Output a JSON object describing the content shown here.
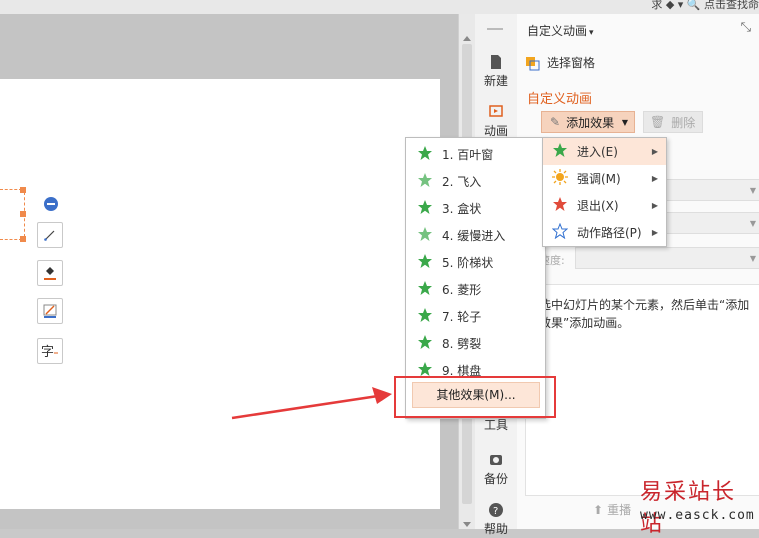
{
  "topbar": {
    "search_text": "求  ◆ ▾  🔍 点击查找命"
  },
  "sidebar": {
    "items": [
      {
        "label": "新建",
        "icon": "new-file-icon"
      },
      {
        "label": "动画",
        "icon": "animation-icon"
      },
      {
        "label": "工具",
        "icon": "tools-icon"
      },
      {
        "label": "备份",
        "icon": "backup-icon"
      },
      {
        "label": "帮助",
        "icon": "help-icon"
      }
    ]
  },
  "panel": {
    "title": "自定义动画",
    "select_pane": "选择窗格",
    "section": "自定义动画",
    "add_effect": "添加效果",
    "delete": "删除",
    "speed_label": "速度:",
    "hint": "选中幻灯片的某个元素，然后单击“添加效果”添加动画。",
    "reset": "重播"
  },
  "effects_menu": {
    "items": [
      "1. 百叶窗",
      "2. 飞入",
      "3. 盒状",
      "4. 缓慢进入",
      "5. 阶梯状",
      "6. 菱形",
      "7. 轮子",
      "8. 劈裂",
      "9. 棋盘"
    ],
    "more": "其他效果(M)...",
    "star_color": "#3aa84a"
  },
  "category_menu": {
    "items": [
      {
        "label": "进入(E)",
        "icon": "enter-star-icon",
        "color": "#3aa84a"
      },
      {
        "label": "强调(M)",
        "icon": "emphasis-sun-icon",
        "color": "#f2a51f"
      },
      {
        "label": "退出(X)",
        "icon": "exit-star-icon",
        "color": "#e04b3a"
      },
      {
        "label": "动作路径(P)",
        "icon": "motion-path-star-icon",
        "color": "#2f6fd0"
      }
    ]
  },
  "watermark": {
    "cn": "易采站长站",
    "url": "www.easck.com"
  },
  "colors": {
    "accent": "#e0601e",
    "highlight": "#fde6d8",
    "annotation_red": "#e53a3a"
  }
}
